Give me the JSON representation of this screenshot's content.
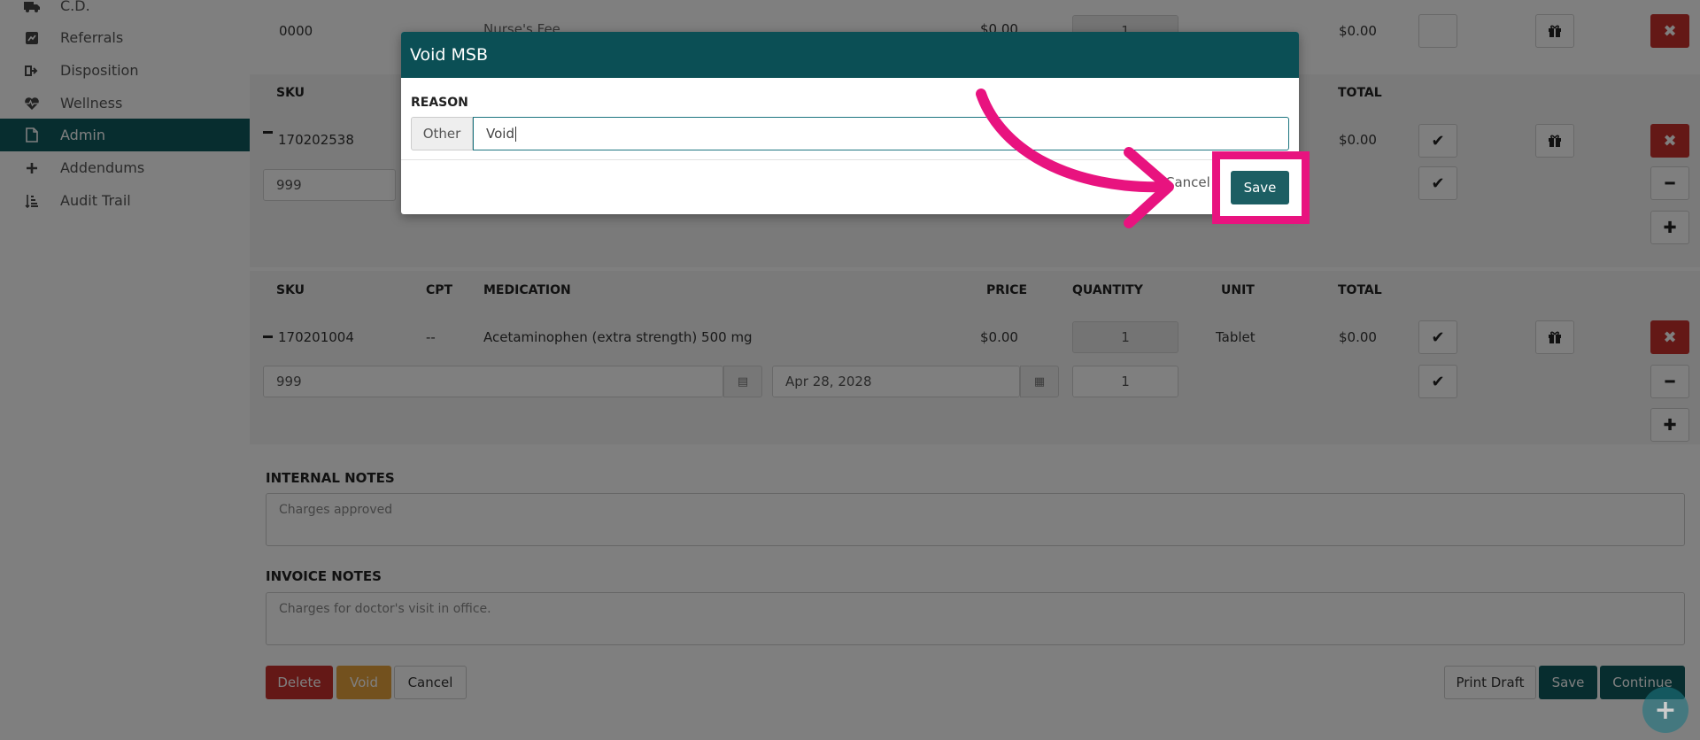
{
  "sidebar": {
    "items": [
      {
        "label": "C.D.",
        "icon": "ambulance-icon"
      },
      {
        "label": "Referrals",
        "icon": "chart-icon"
      },
      {
        "label": "Disposition",
        "icon": "sign-out-icon"
      },
      {
        "label": "Wellness",
        "icon": "heartbeat-icon"
      },
      {
        "label": "Admin",
        "icon": "file-icon"
      },
      {
        "label": "Addendums",
        "icon": "plus-icon"
      },
      {
        "label": "Audit Trail",
        "icon": "sort-icon"
      }
    ],
    "active": "Admin"
  },
  "top_row": {
    "sku": "0000",
    "description": "Nurse's Fee",
    "price": "$0.00",
    "quantity": "1",
    "total": "$0.00"
  },
  "section1": {
    "headers": {
      "sku": "SKU",
      "total": "TOTAL"
    },
    "row": {
      "sku": "170202538",
      "total": "$0.00"
    },
    "lot_value": "999"
  },
  "section2": {
    "headers": {
      "sku": "SKU",
      "cpt": "CPT",
      "medication": "MEDICATION",
      "price": "PRICE",
      "quantity": "QUANTITY",
      "unit": "UNIT",
      "total": "TOTAL"
    },
    "row": {
      "sku": "170201004",
      "cpt": "--",
      "medication": "Acetaminophen (extra strength) 500 mg",
      "price": "$0.00",
      "quantity": "1",
      "unit": "Tablet",
      "total": "$0.00"
    },
    "lot_value": "999",
    "expiry": "Apr 28, 2028",
    "lot_quantity": "1"
  },
  "notes": {
    "internal_label": "INTERNAL NOTES",
    "internal_value": "Charges approved",
    "invoice_label": "INVOICE NOTES",
    "invoice_value": "Charges for doctor's visit in office."
  },
  "actions": {
    "delete": "Delete",
    "void": "Void",
    "cancel": "Cancel",
    "print_draft": "Print Draft",
    "save": "Save",
    "continue": "Continue",
    "fab": "+"
  },
  "modal": {
    "title": "Void MSB",
    "reason_label": "REASON",
    "reason_addon": "Other",
    "reason_value": "Void",
    "cancel": "Cancel",
    "save": "Save"
  },
  "colors": {
    "teal": "#0f5a5f",
    "highlight": "#e8137f",
    "danger": "#c9302c",
    "warning": "#e6a23c"
  }
}
